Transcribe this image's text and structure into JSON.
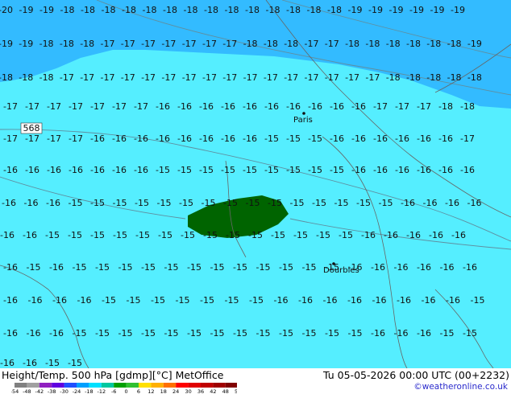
{
  "map": {
    "colors": {
      "light": "#55EEFF",
      "dark": "#33BBFF",
      "green": "#006400",
      "contour": "#5f8fa0",
      "border": "#666666"
    },
    "contour_label": "568",
    "cities": [
      {
        "name": "Paris"
      },
      {
        "name": "Dourbies"
      }
    ],
    "rows": [
      [
        "20",
        "19",
        "19",
        "18",
        "18",
        "18",
        "18",
        "18",
        "18",
        "18",
        "18",
        "18",
        "18",
        "18",
        "18",
        "18",
        "18",
        "19",
        "19",
        "19",
        "19",
        "19",
        "19"
      ],
      [
        "19",
        "19",
        "18",
        "18",
        "18",
        "17",
        "17",
        "17",
        "17",
        "17",
        "17",
        "17",
        "18",
        "18",
        "18",
        "17",
        "17",
        "18",
        "18",
        "18",
        "18",
        "18",
        "18",
        "19"
      ],
      [
        "18",
        "18",
        "18",
        "17",
        "17",
        "17",
        "17",
        "17",
        "17",
        "17",
        "17",
        "17",
        "17",
        "17",
        "17",
        "17",
        "17",
        "17",
        "17",
        "18",
        "18",
        "18",
        "18",
        "18"
      ],
      [
        "17",
        "17",
        "17",
        "17",
        "17",
        "17",
        "17",
        "16",
        "16",
        "16",
        "16",
        "16",
        "16",
        "16",
        "16",
        "16",
        "16",
        "17",
        "17",
        "17",
        "18",
        "18"
      ],
      [
        "17",
        "17",
        "17",
        "17",
        "16",
        "16",
        "16",
        "16",
        "16",
        "16",
        "16",
        "16",
        "15",
        "15",
        "15",
        "16",
        "16",
        "16",
        "16",
        "16",
        "16",
        "17"
      ],
      [
        "16",
        "16",
        "16",
        "16",
        "16",
        "16",
        "16",
        "15",
        "15",
        "15",
        "15",
        "15",
        "15",
        "15",
        "15",
        "15",
        "16",
        "16",
        "16",
        "16",
        "16",
        "16"
      ],
      [
        "16",
        "16",
        "16",
        "15",
        "15",
        "15",
        "15",
        "15",
        "15",
        "15",
        "15",
        "15",
        "15",
        "15",
        "15",
        "15",
        "15",
        "15",
        "16",
        "16",
        "16",
        "16"
      ],
      [
        "16",
        "16",
        "15",
        "15",
        "15",
        "15",
        "15",
        "15",
        "15",
        "15",
        "15",
        "15",
        "15",
        "15",
        "15",
        "15",
        "16",
        "16",
        "16",
        "16",
        "16"
      ],
      [
        "16",
        "15",
        "16",
        "15",
        "15",
        "15",
        "15",
        "15",
        "15",
        "15",
        "15",
        "15",
        "15",
        "15",
        "15",
        "16",
        "16",
        "16",
        "16",
        "16",
        "16"
      ],
      [
        "16",
        "16",
        "16",
        "16",
        "15",
        "15",
        "15",
        "15",
        "15",
        "15",
        "15",
        "16",
        "16",
        "16",
        "16",
        "16",
        "16",
        "16",
        "16",
        "15"
      ],
      [
        "16",
        "16",
        "16",
        "15",
        "15",
        "15",
        "15",
        "15",
        "15",
        "15",
        "15",
        "15",
        "15",
        "15",
        "15",
        "15",
        "16",
        "16",
        "16",
        "15",
        "15"
      ],
      [
        "16",
        "16",
        "15",
        "15"
      ]
    ]
  },
  "footer": {
    "title_left": "Height/Temp. 500 hPa [gdmp][°C] MetOffice",
    "title_right": "Tu 05-05-2026 00:00 UTC (00+2232)",
    "copyright": "©weatheronline.co.uk",
    "legend": {
      "ticks": [
        "-54",
        "-48",
        "-42",
        "-38",
        "-30",
        "-24",
        "-18",
        "-12",
        "-6",
        "0",
        "6",
        "12",
        "18",
        "24",
        "30",
        "36",
        "42",
        "48",
        "54"
      ],
      "colors": [
        "#808080",
        "#a0a0a0",
        "#9020c0",
        "#6000e0",
        "#2050ff",
        "#00a0ff",
        "#00e0ff",
        "#00c8a0",
        "#00a000",
        "#30c030",
        "#ffe000",
        "#ffb000",
        "#ff7000",
        "#ff0000",
        "#e00000",
        "#c00000",
        "#a00000",
        "#800000"
      ]
    }
  }
}
